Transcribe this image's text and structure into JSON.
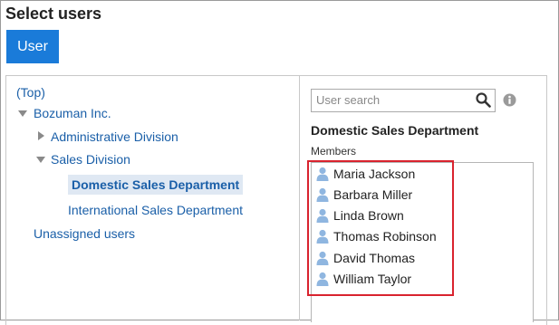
{
  "page": {
    "title": "Select users"
  },
  "tabs": [
    {
      "label": "User"
    }
  ],
  "tree": {
    "top": "(Top)",
    "company": "Bozuman Inc.",
    "admin_division": "Administrative Division",
    "sales_division": "Sales Division",
    "domestic_sales": "Domestic Sales Department",
    "international_sales": "International Sales Department",
    "unassigned": "Unassigned users"
  },
  "search": {
    "placeholder": "User search"
  },
  "selection": {
    "department_title": "Domestic Sales Department",
    "members_label": "Members",
    "members": [
      "Maria Jackson",
      "Barbara Miller",
      "Linda Brown",
      "Thomas Robinson",
      "David Thomas",
      "William Taylor"
    ]
  },
  "colors": {
    "accent": "#1a7bd9",
    "link": "#1a5fa8",
    "highlight_border": "#d9232e",
    "selected_bg": "#dfe8f3"
  }
}
